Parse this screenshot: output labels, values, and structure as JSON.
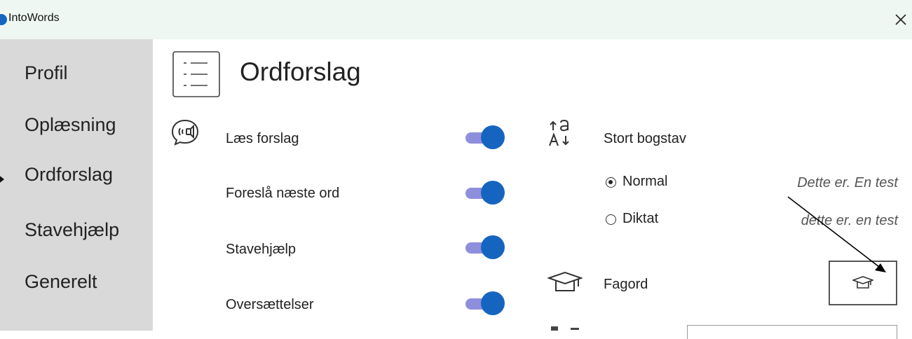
{
  "window": {
    "title": "IntoWords",
    "close_icon": "close-icon"
  },
  "sidebar": {
    "items": [
      {
        "label": "Profil",
        "active": false
      },
      {
        "label": "Oplæsning",
        "active": false
      },
      {
        "label": "Ordforslag",
        "active": true
      },
      {
        "label": "Stavehjælp",
        "active": false
      },
      {
        "label": "Generelt",
        "active": false
      }
    ]
  },
  "page": {
    "title": "Ordforslag",
    "icon": "list-icon"
  },
  "toggles": [
    {
      "label": "Læs forslag",
      "on": true
    },
    {
      "label": "Foreslå næste ord",
      "on": true
    },
    {
      "label": "Stavehjælp",
      "on": true
    },
    {
      "label": "Oversættelser",
      "on": true
    }
  ],
  "capital": {
    "label": "Stort bogstav",
    "icon": "text-case-icon",
    "options": [
      {
        "label": "Normal",
        "selected": true,
        "example": "Dette er. En test"
      },
      {
        "label": "Diktat",
        "selected": false,
        "example": "dette er. en test"
      }
    ]
  },
  "fagord": {
    "label": "Fagord",
    "icon": "graduation-cap-icon"
  },
  "colors": {
    "accent": "#1565c0",
    "toggle_track": "#8e8fdc",
    "sidebar_bg": "#d9d9d9",
    "titlebar_bg": "#eef7f2"
  }
}
